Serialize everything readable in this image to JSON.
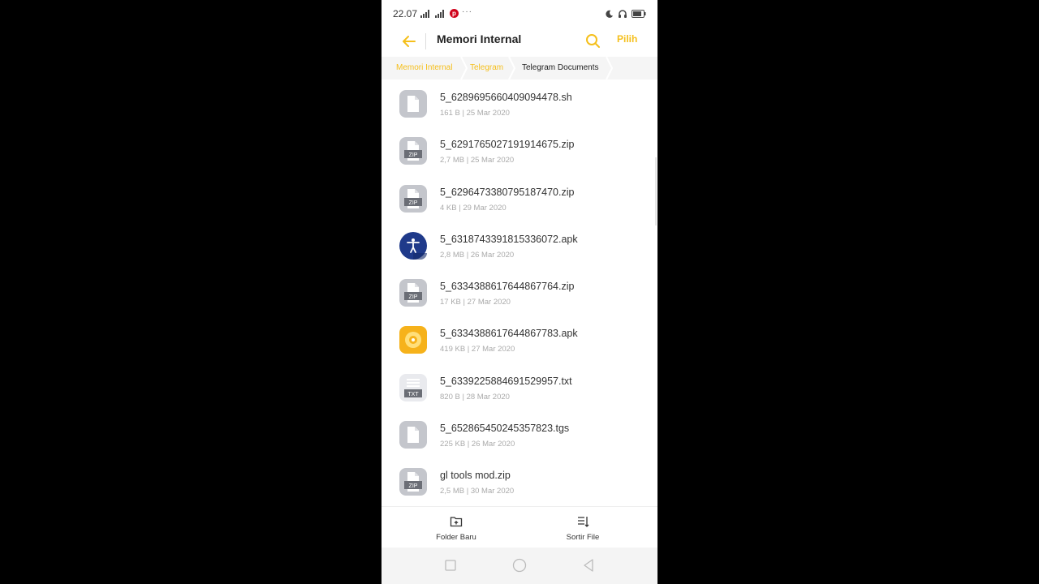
{
  "status_bar": {
    "time": "22.07"
  },
  "header": {
    "title": "Memori Internal",
    "select_label": "Pilih"
  },
  "breadcrumb": [
    "Memori Internal",
    "Telegram",
    "Telegram Documents"
  ],
  "files": [
    {
      "name": "5_6289695660409094478.sh",
      "meta": "161 B | 25 Mar 2020",
      "icon": "generic-file-icon"
    },
    {
      "name": "5_6291765027191914675.zip",
      "meta": "2,7 MB | 25 Mar 2020",
      "icon": "zip-file-icon",
      "icon_text": "ZIP"
    },
    {
      "name": "5_6296473380795187470.zip",
      "meta": "4 KB | 29 Mar 2020",
      "icon": "zip-file-icon",
      "icon_text": "ZIP"
    },
    {
      "name": "5_6318743391815336072.apk",
      "meta": "2,8 MB | 26 Mar 2020",
      "icon": "accessibility-app-icon"
    },
    {
      "name": "5_6334388617644867764.zip",
      "meta": "17 KB | 27 Mar 2020",
      "icon": "zip-file-icon",
      "icon_text": "ZIP"
    },
    {
      "name": "5_6334388617644867783.apk",
      "meta": "419 KB | 27 Mar 2020",
      "icon": "apk-app-icon"
    },
    {
      "name": "5_6339225884691529957.txt",
      "meta": "820 B | 28 Mar 2020",
      "icon": "txt-file-icon",
      "icon_text": "TXT"
    },
    {
      "name": "5_652865450245357823.tgs",
      "meta": "225 KB | 26 Mar 2020",
      "icon": "generic-file-icon"
    },
    {
      "name": "gl tools mod.zip",
      "meta": "2,5 MB | 30 Mar 2020",
      "icon": "zip-file-icon",
      "icon_text": "ZIP"
    }
  ],
  "bottom_bar": {
    "new_folder_label": "Folder Baru",
    "sort_label": "Sortir File"
  },
  "colors": {
    "accent": "#f5bf1b",
    "icon_gray": "#c4c6cc",
    "apk_blue": "#1f3a8a",
    "apk_orange": "#f6b21b"
  }
}
